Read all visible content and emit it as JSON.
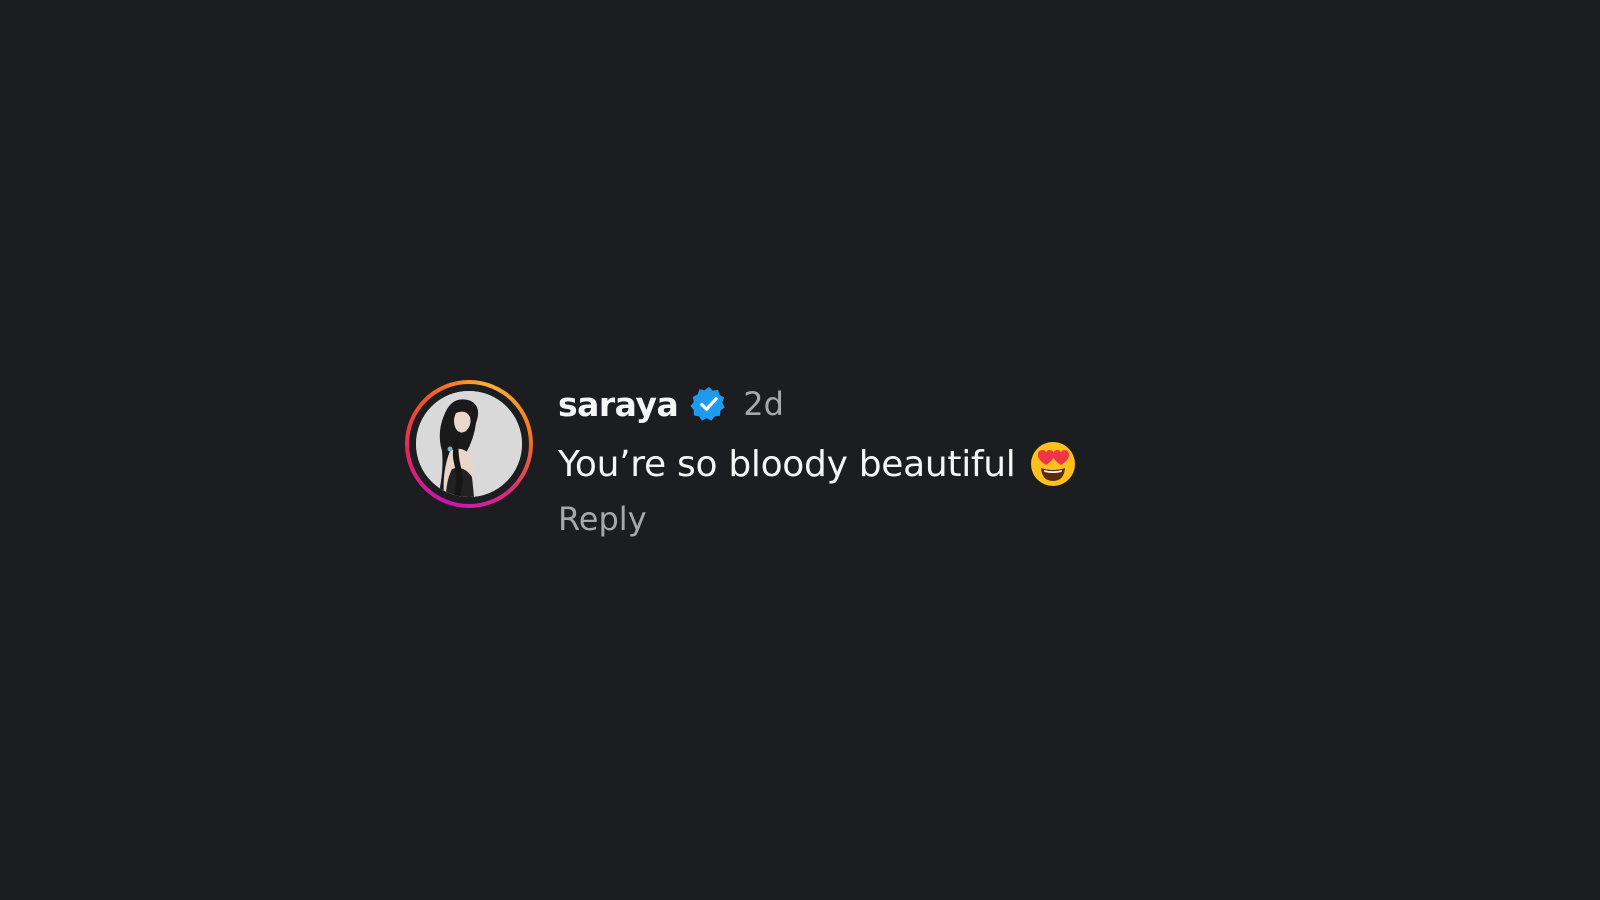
{
  "comment": {
    "username": "saraya",
    "verified": true,
    "time": "2d",
    "text": "You’re so bloody beautiful",
    "emoji": "smiling-face-with-heart-eyes",
    "reply_label": "Reply"
  },
  "colors": {
    "background": "#1b1d20",
    "primary_text": "#f5f5f5",
    "secondary_text": "#a8a8a8",
    "verified_badge": "#1d9bf0",
    "story_ring_start": "#c913b9",
    "story_ring_end": "#fbb03b"
  }
}
